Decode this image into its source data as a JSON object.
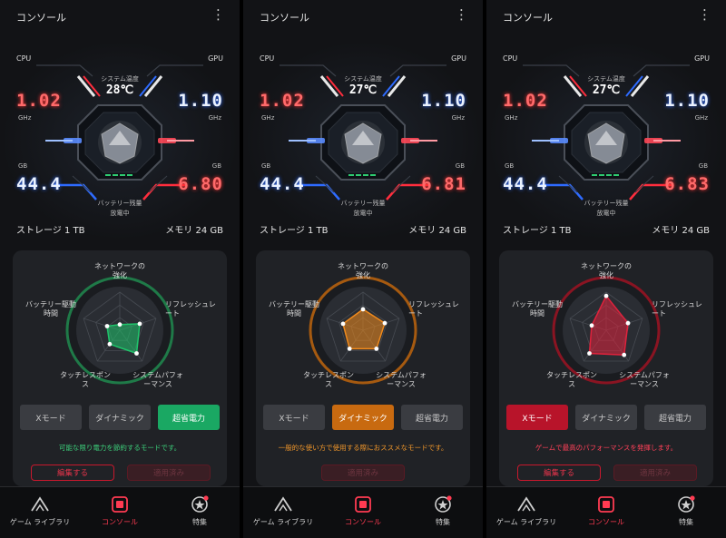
{
  "panels": [
    {
      "title": "コンソール",
      "menu": "⋮",
      "dash": {
        "cpu_label": "CPU",
        "gpu_label": "GPU",
        "temp_caption": "システム温度",
        "temp": "28℃",
        "cpu_value": "1.02",
        "gpu_value": "1.10",
        "ghz_left": "GHz",
        "ghz_right": "GHz",
        "gb_left": "GB",
        "gb_right": "GB",
        "mem_value": "44.4",
        "vram_value": "6.80",
        "battery_caption": "バッテリー残量",
        "battery_status": "放電中",
        "storage": "ストレージ 1 TB",
        "memory": "メモリ 24 GB"
      },
      "radar": {
        "top": "ネットワークの\n強化",
        "left": "バッテリー駆動\n時間",
        "right": "リフレッシュレ\nート",
        "bottom_left": "タッチレスポン\nス",
        "bottom_right": "システムパフォ\nーマンス",
        "color": "#1fc46b",
        "ring": "#1f7a48",
        "values": [
          0.15,
          0.35,
          0.55,
          0.45,
          0.75
        ]
      },
      "modes": [
        "Xモード",
        "ダイナミック",
        "超省電力"
      ],
      "active_mode": 2,
      "active_color": "#1aa863",
      "description": "可能な限り電力を節約するモードです。",
      "desc_color": "#3ccf7a",
      "edit_label": "編集する",
      "applied_label": "適用済み",
      "show_edit": true
    },
    {
      "title": "コンソール",
      "menu": "⋮",
      "dash": {
        "cpu_label": "CPU",
        "gpu_label": "GPU",
        "temp_caption": "システム温度",
        "temp": "27℃",
        "cpu_value": "1.02",
        "gpu_value": "1.10",
        "ghz_left": "GHz",
        "ghz_right": "GHz",
        "gb_left": "GB",
        "gb_right": "GB",
        "mem_value": "44.4",
        "vram_value": "6.81",
        "battery_caption": "バッテリー残量",
        "battery_status": "放電中",
        "storage": "ストレージ 1 TB",
        "memory": "メモリ 24 GB"
      },
      "radar": {
        "top": "ネットワークの\n強化",
        "left": "バッテリー駆動\n時間",
        "right": "リフレッシュレ\nート",
        "bottom_left": "タッチレスポン\nス",
        "bottom_right": "システムパフォ\nーマンス",
        "color": "#f08a1c",
        "ring": "#a65a10",
        "values": [
          0.55,
          0.55,
          0.6,
          0.6,
          0.6
        ]
      },
      "modes": [
        "Xモード",
        "ダイナミック",
        "超省電力"
      ],
      "active_mode": 1,
      "active_color": "#c86a10",
      "description": "一般的な使い方で使用する際におススメなモードです。",
      "desc_color": "#f0962a",
      "edit_label": "",
      "applied_label": "適用済み",
      "show_edit": false
    },
    {
      "title": "コンソール",
      "menu": "⋮",
      "dash": {
        "cpu_label": "CPU",
        "gpu_label": "GPU",
        "temp_caption": "システム温度",
        "temp": "27℃",
        "cpu_value": "1.02",
        "gpu_value": "1.10",
        "ghz_left": "GHz",
        "ghz_right": "GHz",
        "gb_left": "GB",
        "gb_right": "GB",
        "mem_value": "44.4",
        "vram_value": "6.83",
        "battery_caption": "バッテリー残量",
        "battery_status": "放電中",
        "storage": "ストレージ 1 TB",
        "memory": "メモリ 24 GB"
      },
      "radar": {
        "top": "ネットワークの\n強化",
        "left": "バッテリー駆動\n時間",
        "right": "リフレッシュレ\nート",
        "bottom_left": "タッチレスポン\nス",
        "bottom_right": "システムパフォ\nーマンス",
        "color": "#e0223c",
        "ring": "#8a1422",
        "values": [
          0.9,
          0.4,
          0.6,
          0.75,
          0.8
        ]
      },
      "modes": [
        "Xモード",
        "ダイナミック",
        "超省電力"
      ],
      "active_mode": 0,
      "active_color": "#b8142a",
      "description": "ゲームで最高のパフォーマンスを発揮します。",
      "desc_color": "#ff4058",
      "edit_label": "編集する",
      "applied_label": "適用済み",
      "show_edit": true
    }
  ],
  "nav": {
    "items": [
      "ゲーム ライブラリ",
      "コンソール",
      "特集"
    ],
    "active": 1,
    "active_color": "#ff3b52"
  }
}
